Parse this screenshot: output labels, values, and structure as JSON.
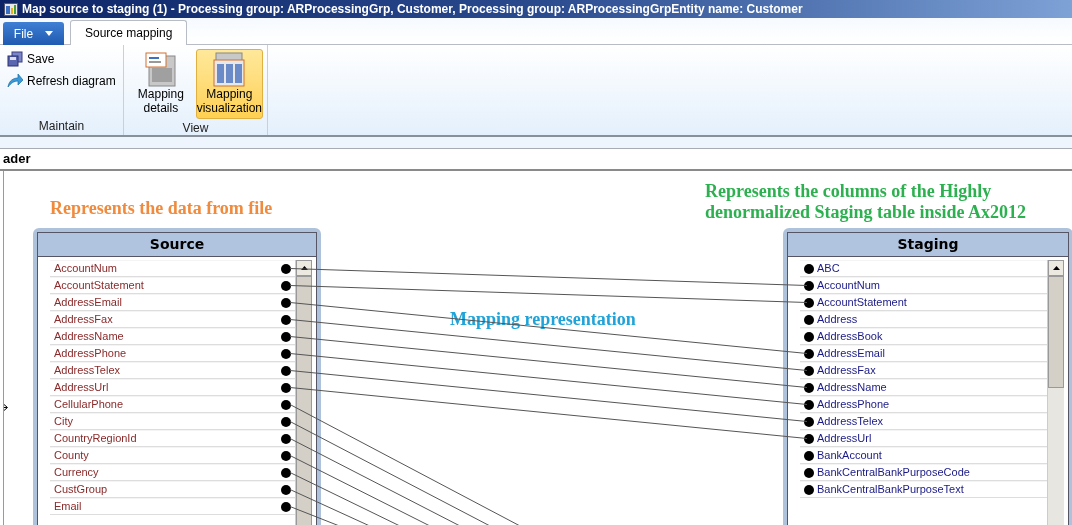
{
  "window": {
    "title": "Map source to staging (1) - Processing group: ARProcessingGrp, Customer, Processing group: ARProcessingGrpEntity name: Customer"
  },
  "tabs": [
    {
      "label": "File",
      "kind": "menu",
      "selected": false
    },
    {
      "label": "Source mapping",
      "kind": "tab",
      "selected": true
    }
  ],
  "ribbon_groups": [
    {
      "label": "Maintain",
      "kind": "small",
      "buttons": [
        {
          "label": "Save",
          "selected": false
        },
        {
          "label": "Refresh diagram",
          "selected": false
        }
      ]
    },
    {
      "label": "View",
      "kind": "large",
      "buttons": [
        {
          "label": "Mapping details",
          "selected": false
        },
        {
          "label": "Mapping visualization",
          "selected": true
        }
      ]
    }
  ],
  "section_header": "ader",
  "annotations": [
    {
      "text": "Represents the data from file",
      "color": "#f08a3c"
    },
    {
      "text": "Mapping representation",
      "color": "#1fa3d8"
    },
    {
      "text": "Represents the columns of the Highly denormalized Staging table inside Ax2012",
      "color": "#2db04f"
    }
  ],
  "source": {
    "title": "Source",
    "fields": [
      "AccountNum",
      "AccountStatement",
      "AddressEmail",
      "AddressFax",
      "AddressName",
      "AddressPhone",
      "AddressTelex",
      "AddressUrl",
      "CellularPhone",
      "City",
      "CountryRegionId",
      "County",
      "Currency",
      "CustGroup",
      "Email"
    ]
  },
  "staging": {
    "title": "Staging",
    "fields": [
      "ABC",
      "AccountNum",
      "AccountStatement",
      "Address",
      "AddressBook",
      "AddressEmail",
      "AddressFax",
      "AddressName",
      "AddressPhone",
      "AddressTelex",
      "AddressUrl",
      "BankAccount",
      "BankCentralBankPurposeCode",
      "BankCentralBankPurposeText"
    ]
  }
}
